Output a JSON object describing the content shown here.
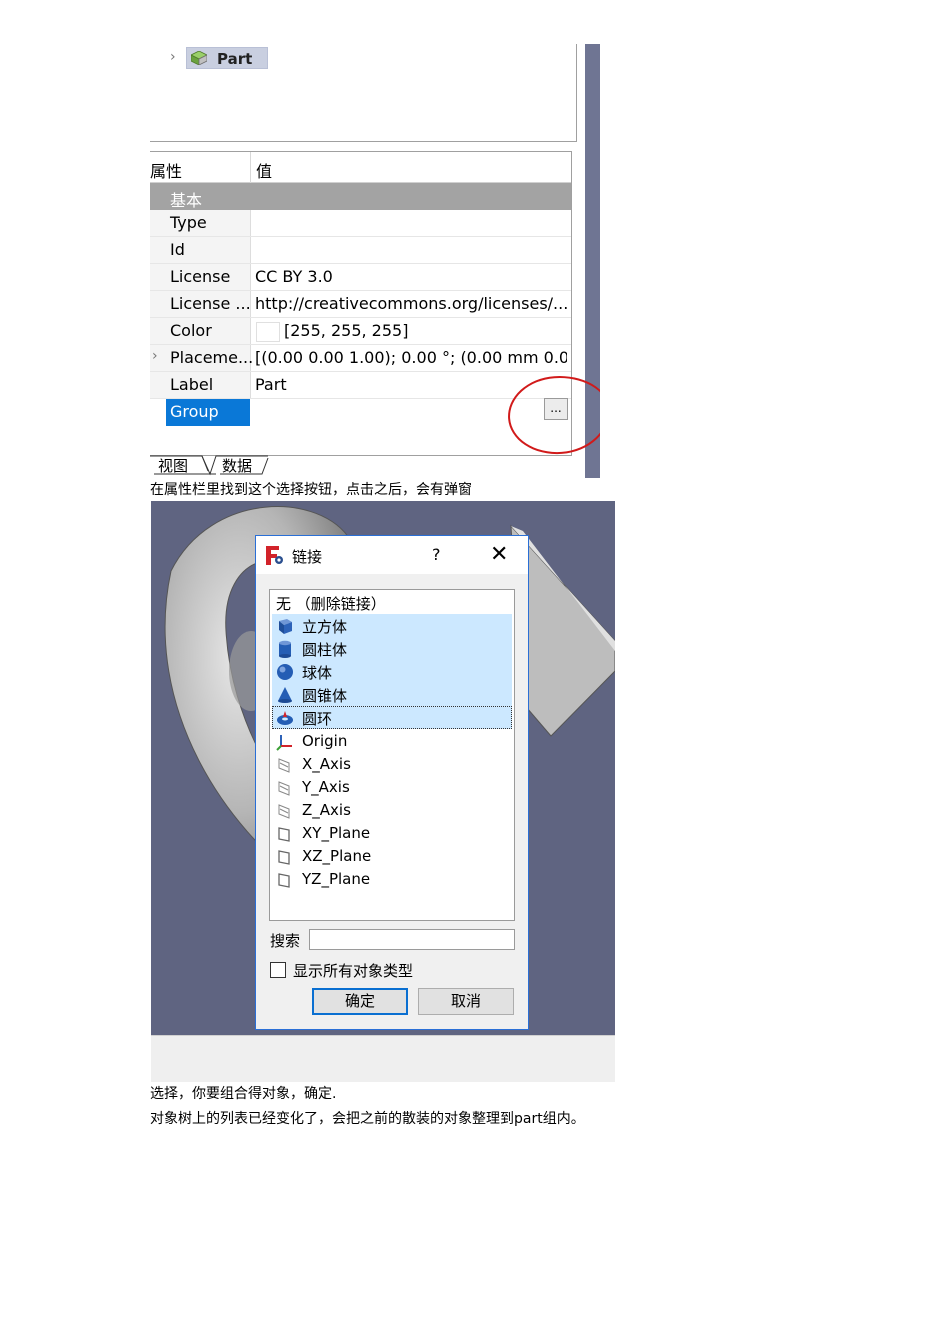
{
  "screenshot1": {
    "tree": {
      "expand_glyph": "›",
      "node_label": "Part"
    },
    "properties": {
      "header": {
        "property": "属性",
        "value": "值"
      },
      "group_label": "基本",
      "rows": [
        {
          "key": "Type",
          "value": ""
        },
        {
          "key": "Id",
          "value": ""
        },
        {
          "key": "License",
          "value": "CC BY 3.0"
        },
        {
          "key": "License ...",
          "value": "http://creativecommons.org/licenses/..."
        },
        {
          "key": "Color",
          "value": "[255, 255, 255]"
        },
        {
          "key": "Placeme...",
          "value": "[(0.00 0.00 1.00); 0.00 °; (0.00 mm  0.00..."
        },
        {
          "key": "Label",
          "value": "Part"
        },
        {
          "key": "Group",
          "value": ""
        }
      ],
      "placement_expand_glyph": "›",
      "dots_button": "..."
    },
    "tabs": [
      "视图",
      "数据"
    ]
  },
  "caption1": "在属性栏里找到这个选择按钮，点击之后，会有弹窗",
  "dialog": {
    "title": "链接",
    "help": "?",
    "close": "✕",
    "items": [
      {
        "label": "无 （删除链接）",
        "icon": "none"
      },
      {
        "label": "立方体",
        "icon": "cube-icon"
      },
      {
        "label": "圆柱体",
        "icon": "cylinder-icon"
      },
      {
        "label": "球体",
        "icon": "sphere-icon"
      },
      {
        "label": "圆锥体",
        "icon": "cone-icon"
      },
      {
        "label": "圆环",
        "icon": "torus-icon"
      },
      {
        "label": "Origin",
        "icon": "origin-icon"
      },
      {
        "label": "X_Axis",
        "icon": "axis-icon"
      },
      {
        "label": "Y_Axis",
        "icon": "axis-icon"
      },
      {
        "label": "Z_Axis",
        "icon": "axis-icon"
      },
      {
        "label": "XY_Plane",
        "icon": "plane-icon"
      },
      {
        "label": "XZ_Plane",
        "icon": "plane-icon"
      },
      {
        "label": "YZ_Plane",
        "icon": "plane-icon"
      }
    ],
    "search_label": "搜索",
    "search_value": "",
    "show_all_label": "显示所有对象类型",
    "ok": "确定",
    "cancel": "取消"
  },
  "caption2": "选择，你要组合得对象，确定.",
  "caption3": "对象树上的列表已经变化了，会把之前的散装的对象整理到part组内。"
}
